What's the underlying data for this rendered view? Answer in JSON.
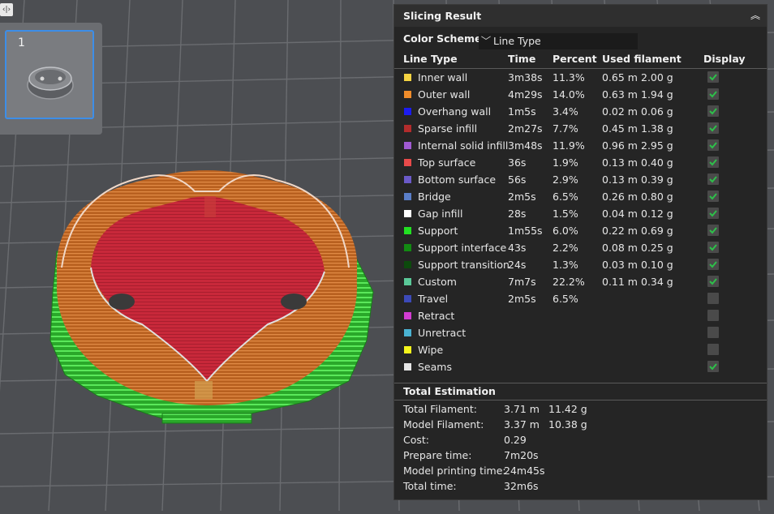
{
  "thumbnail": {
    "number": "1"
  },
  "panel": {
    "title": "Slicing Result",
    "color_scheme_label": "Color Scheme",
    "color_scheme_value": "Line Type",
    "headers": {
      "line_type": "Line Type",
      "time": "Time",
      "percent": "Percent",
      "used_filament": "Used filament",
      "display": "Display"
    },
    "rows": [
      {
        "name": "Inner wall",
        "color": "#f5d442",
        "time": "3m38s",
        "percent": "11.3%",
        "length": "0.65 m",
        "weight": "2.00 g",
        "display": true
      },
      {
        "name": "Outer wall",
        "color": "#f08c2a",
        "time": "4m29s",
        "percent": "14.0%",
        "length": "0.63 m",
        "weight": "1.94 g",
        "display": true
      },
      {
        "name": "Overhang wall",
        "color": "#1c1cf0",
        "time": "1m5s",
        "percent": "3.4%",
        "length": "0.02 m",
        "weight": "0.06 g",
        "display": true
      },
      {
        "name": "Sparse infill",
        "color": "#b22c2c",
        "time": "2m27s",
        "percent": "7.7%",
        "length": "0.45 m",
        "weight": "1.38 g",
        "display": true
      },
      {
        "name": "Internal solid infill",
        "color": "#a05ad2",
        "time": "3m48s",
        "percent": "11.9%",
        "length": "0.96 m",
        "weight": "2.95 g",
        "display": true
      },
      {
        "name": "Top surface",
        "color": "#e84a4a",
        "time": "36s",
        "percent": "1.9%",
        "length": "0.13 m",
        "weight": "0.40 g",
        "display": true
      },
      {
        "name": "Bottom surface",
        "color": "#6b5ac8",
        "time": "56s",
        "percent": "2.9%",
        "length": "0.13 m",
        "weight": "0.39 g",
        "display": true
      },
      {
        "name": "Bridge",
        "color": "#5a7ec8",
        "time": "2m5s",
        "percent": "6.5%",
        "length": "0.26 m",
        "weight": "0.80 g",
        "display": true
      },
      {
        "name": "Gap infill",
        "color": "#ffffff",
        "time": "28s",
        "percent": "1.5%",
        "length": "0.04 m",
        "weight": "0.12 g",
        "display": true
      },
      {
        "name": "Support",
        "color": "#22e022",
        "time": "1m55s",
        "percent": "6.0%",
        "length": "0.22 m",
        "weight": "0.69 g",
        "display": true
      },
      {
        "name": "Support interface",
        "color": "#128a12",
        "time": "43s",
        "percent": "2.2%",
        "length": "0.08 m",
        "weight": "0.25 g",
        "display": true
      },
      {
        "name": "Support transition",
        "color": "#0c4a0c",
        "time": "24s",
        "percent": "1.3%",
        "length": "0.03 m",
        "weight": "0.10 g",
        "display": true
      },
      {
        "name": "Custom",
        "color": "#5ac898",
        "time": "7m7s",
        "percent": "22.2%",
        "length": "0.11 m",
        "weight": "0.34 g",
        "display": true
      },
      {
        "name": "Travel",
        "color": "#3c4ab8",
        "time": "2m5s",
        "percent": "6.5%",
        "length": "",
        "weight": "",
        "display": false
      },
      {
        "name": "Retract",
        "color": "#d23cd2",
        "time": "",
        "percent": "",
        "length": "",
        "weight": "",
        "display": false
      },
      {
        "name": "Unretract",
        "color": "#4ab2d2",
        "time": "",
        "percent": "",
        "length": "",
        "weight": "",
        "display": false
      },
      {
        "name": "Wipe",
        "color": "#f5f51c",
        "time": "",
        "percent": "",
        "length": "",
        "weight": "",
        "display": false
      },
      {
        "name": "Seams",
        "color": "#e6e6e6",
        "time": "",
        "percent": "",
        "length": "",
        "weight": "",
        "display": true
      }
    ],
    "total_title": "Total Estimation",
    "totals": [
      {
        "label": "Total Filament:",
        "value": "3.71 m",
        "value2": "11.42 g"
      },
      {
        "label": "Model Filament:",
        "value": "3.37 m",
        "value2": "10.38 g"
      },
      {
        "label": "Cost:",
        "value": "0.29",
        "value2": ""
      },
      {
        "label": "Prepare time:",
        "value": "7m20s",
        "value2": ""
      },
      {
        "label": "Model printing time:",
        "value": "24m45s",
        "value2": ""
      },
      {
        "label": "Total time:",
        "value": "32m6s",
        "value2": ""
      }
    ]
  }
}
